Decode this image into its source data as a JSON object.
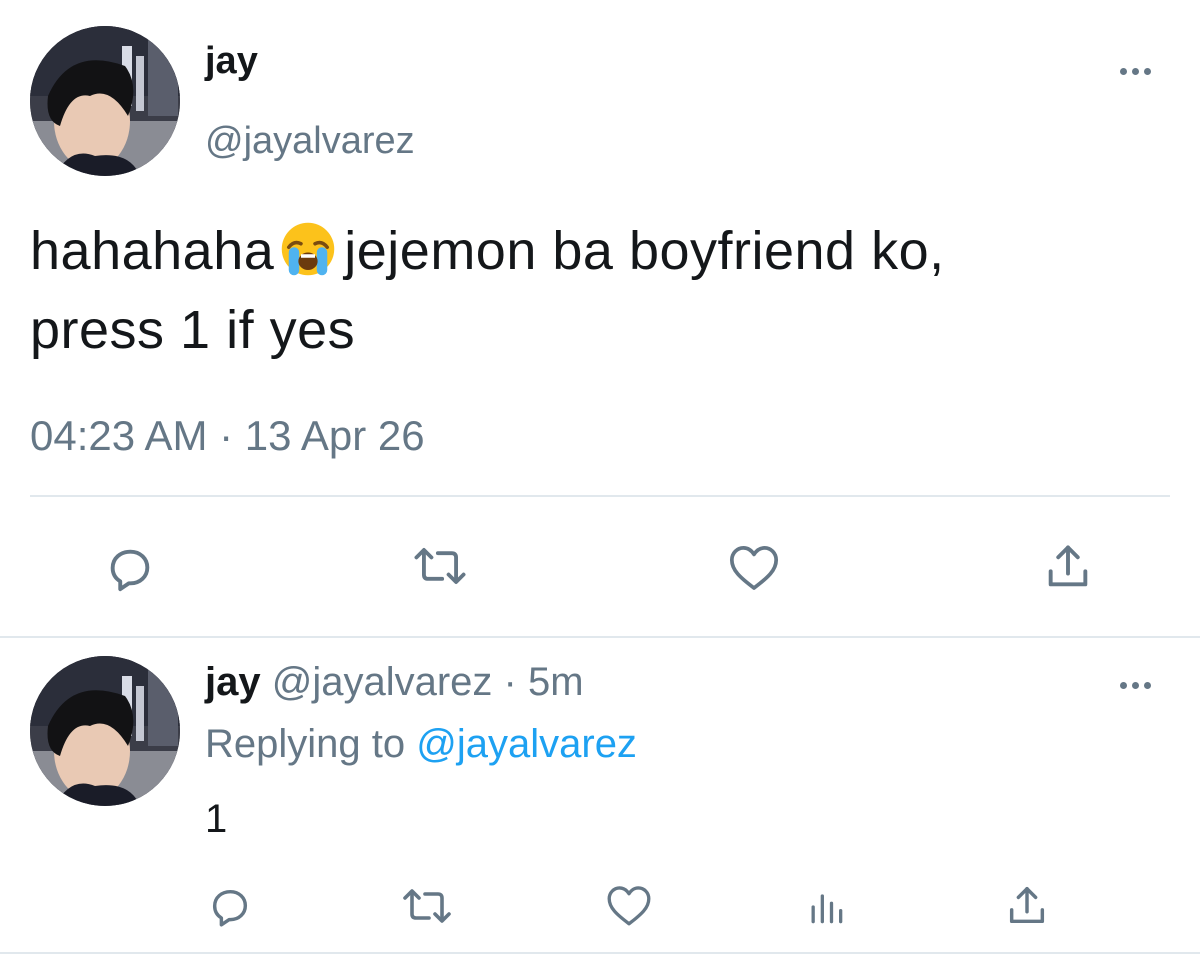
{
  "main_tweet": {
    "author_name": "jay",
    "author_handle": "@jayalvarez",
    "text_part1": "hahahaha",
    "emoji": "loudly-crying-face",
    "text_part2": "jejemon ba boyfriend ko,",
    "text_line2": "press 1 if yes",
    "timestamp": "04:23 AM · 13 Apr 26",
    "actions": [
      "reply-icon",
      "retweet-icon",
      "like-icon",
      "share-icon"
    ]
  },
  "reply_tweet": {
    "author_name": "jay",
    "author_handle": "@jayalvarez",
    "separator": "·",
    "time_ago": "5m",
    "replying_prefix": "Replying to",
    "replying_to": "@jayalvarez",
    "text": "1",
    "actions": [
      "reply-icon",
      "retweet-icon",
      "like-icon",
      "analytics-icon",
      "share-icon"
    ]
  },
  "colors": {
    "text": "#14171a",
    "secondary": "#657786",
    "link": "#1da1f2",
    "divider": "#e1e8ed"
  }
}
